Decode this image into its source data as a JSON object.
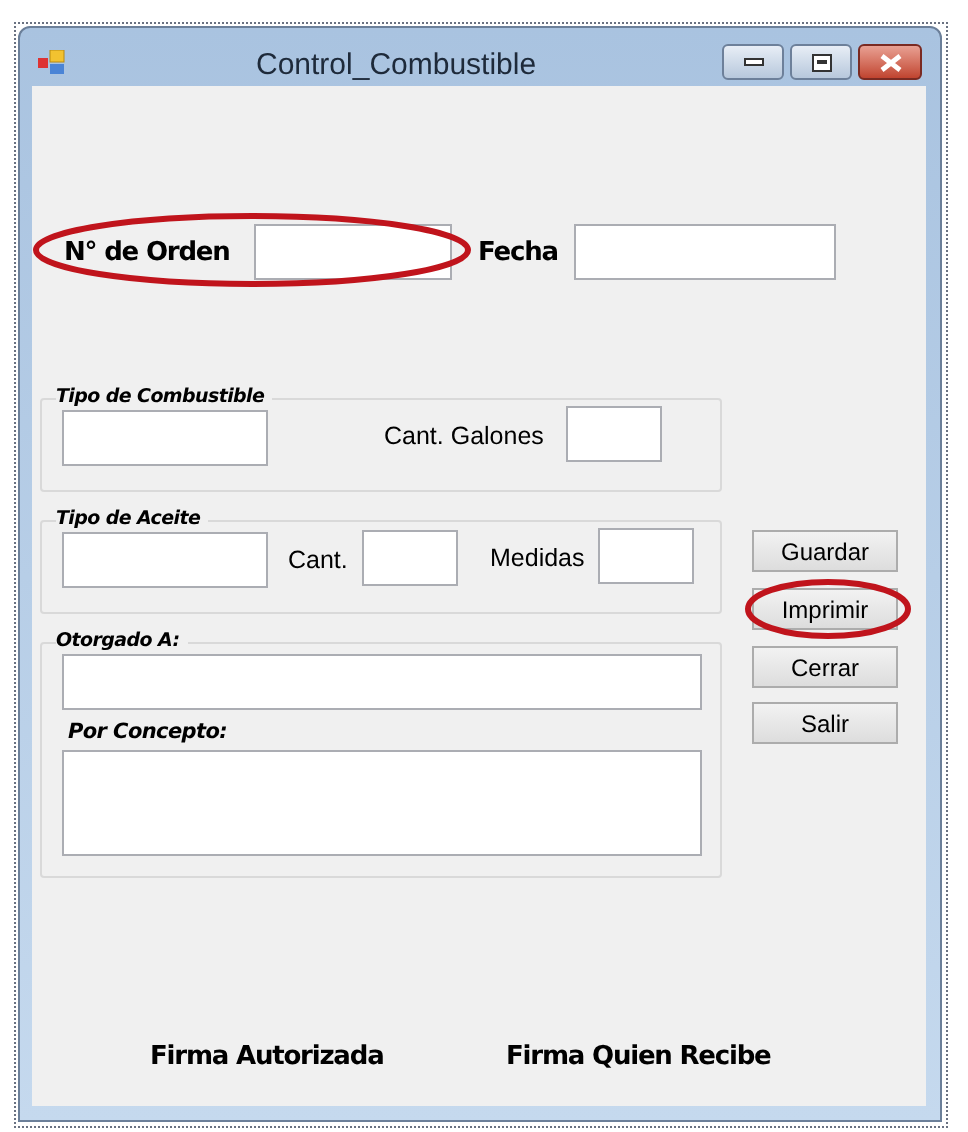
{
  "window": {
    "title": "Control_Combustible"
  },
  "header_fields": [
    {
      "label": "N° de Orden",
      "circled": true
    },
    {
      "label": "Fecha",
      "circled": false
    }
  ],
  "groups": [
    {
      "title": "Tipo de Combustible",
      "fields": [
        {
          "kind": "input"
        },
        {
          "kind": "labeled",
          "label": "Cant. Galones"
        }
      ]
    },
    {
      "title": "Tipo de Aceite",
      "fields": [
        {
          "kind": "input"
        },
        {
          "kind": "labeled",
          "label": "Cant."
        },
        {
          "kind": "labeled",
          "label": "Medidas"
        }
      ]
    },
    {
      "title": "Otorgado A:",
      "fields": [
        {
          "kind": "input"
        },
        {
          "kind": "memo",
          "label": "Por Concepto:"
        }
      ]
    }
  ],
  "buttons": [
    {
      "label": "Guardar",
      "circled": false
    },
    {
      "label": "Imprimir",
      "circled": true
    },
    {
      "label": "Cerrar",
      "circled": false
    },
    {
      "label": "Salir",
      "circled": false
    }
  ],
  "signatures": [
    "Firma Autorizada",
    "Firma Quien Recibe"
  ]
}
